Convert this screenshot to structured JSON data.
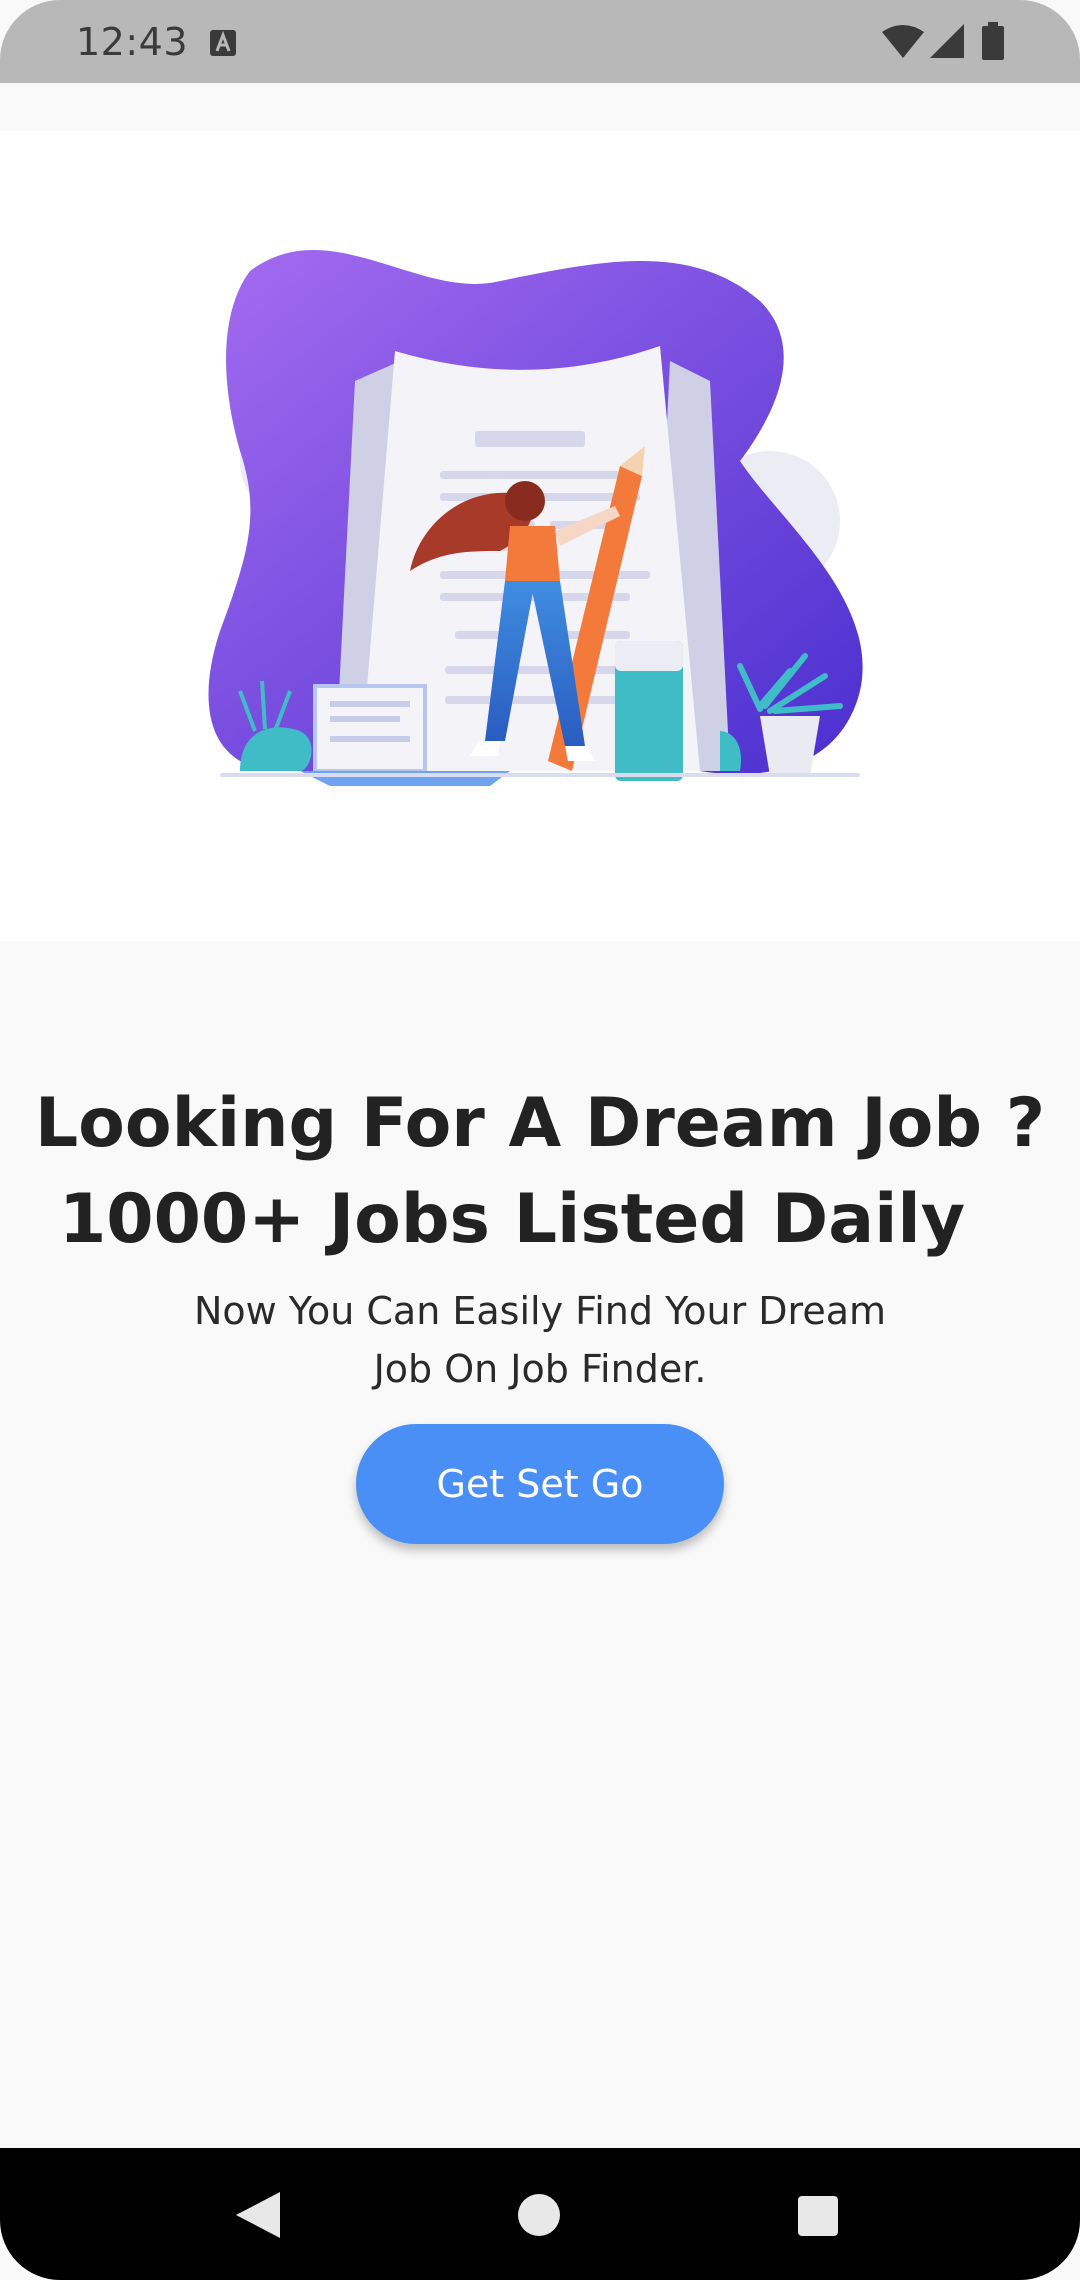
{
  "status_bar": {
    "time": "12:43",
    "icons": [
      "a-icon",
      "wifi-icon",
      "signal-icon",
      "battery-icon"
    ]
  },
  "hero": {
    "illustration": "job-search-illustration",
    "colors": {
      "blob": "#6a3ce0",
      "blob_light": "#a46cf0",
      "pencil": "#f47a3c",
      "teal": "#3fbcc6"
    }
  },
  "content": {
    "headline_line1": "Looking For A Dream Job ?",
    "headline_line2": "1000+ Jobs Listed Daily",
    "subtitle": "Now You Can Easily Find Your Dream Job On Job Finder.",
    "cta_label": "Get Set Go"
  },
  "colors": {
    "accent": "#4a8ff5",
    "background": "#f9f9f9",
    "text": "#222222"
  },
  "nav_bar": {
    "icons": [
      "back-icon",
      "home-icon",
      "recents-icon"
    ]
  }
}
